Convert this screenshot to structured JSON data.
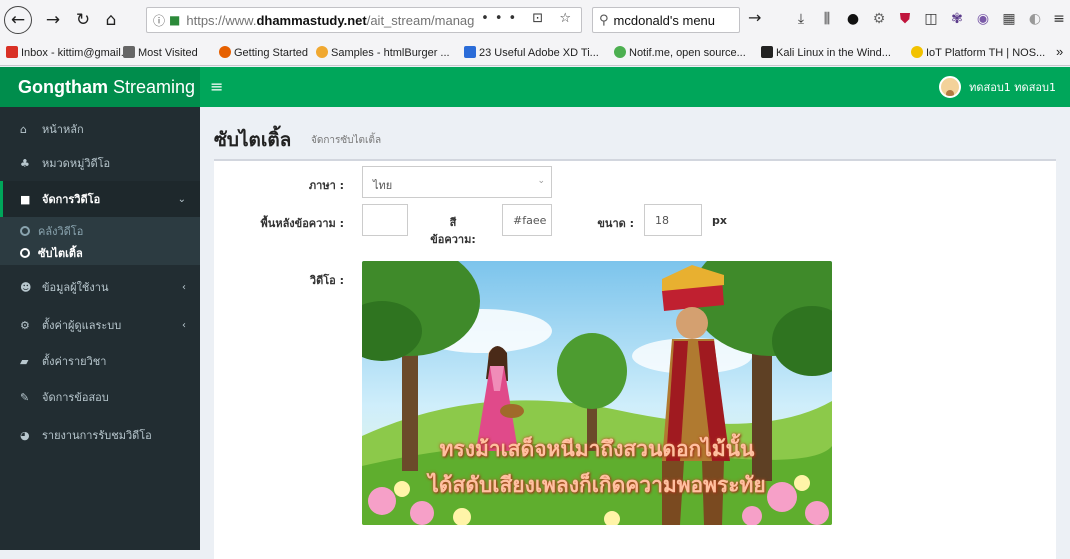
{
  "browser": {
    "url_prefix": "https://www.",
    "url_domain": "dhammastudy.net",
    "url_path": "/ait_stream/manage/subtitl",
    "page_actions": "••• ⊡ ☆",
    "search_text": "mcdonald's menu",
    "bookmarks": [
      {
        "label": "Inbox - kittim@gmail....",
        "color": "#d93025"
      },
      {
        "label": "Most Visited",
        "color": "#666666"
      },
      {
        "label": "Getting Started",
        "color": "#e66000"
      },
      {
        "label": "Samples - htmlBurger ...",
        "color": "#f0a830"
      },
      {
        "label": "23 Useful Adobe XD Ti...",
        "color": "#2b6cd8"
      },
      {
        "label": "Notif.me, open source...",
        "color": "#4caf50"
      },
      {
        "label": "Kali Linux in the Wind...",
        "color": "#222222"
      },
      {
        "label": "IoT Platform TH | NOS...",
        "color": "#f2c200"
      }
    ],
    "overflow": "»"
  },
  "app": {
    "logo_bold": "Gongtham",
    "logo_rest": " Streaming",
    "menu_icon": "≡",
    "user_name": "ทดสอบ1 ทดสอบ1"
  },
  "sidebar": {
    "items": [
      {
        "label": "หน้าหลัก",
        "icon": "home-icon",
        "glyph": "⌂"
      },
      {
        "label": "หมวดหมู่วิดีโอ",
        "icon": "sitemap-icon",
        "glyph": "♣"
      },
      {
        "label": "จัดการวิดีโอ",
        "icon": "video-icon",
        "glyph": "■"
      },
      {
        "label": "ข้อมูลผู้ใช้งาน",
        "icon": "users-icon",
        "glyph": "☻"
      },
      {
        "label": "ตั้งค่าผู้ดูแลระบบ",
        "icon": "cogs-icon",
        "glyph": "⚙"
      },
      {
        "label": "ตั้งค่ารายวิชา",
        "icon": "book-icon",
        "glyph": "▰"
      },
      {
        "label": "จัดการข้อสอบ",
        "icon": "edit-icon",
        "glyph": "✎"
      },
      {
        "label": "รายงานการรับชมวิดีโอ",
        "icon": "chart-pie-icon",
        "glyph": "◕"
      }
    ],
    "sub_items": [
      {
        "label": "คลังวิดีโอ"
      },
      {
        "label": "ซับไตเติ้ล"
      }
    ]
  },
  "page": {
    "title": "ซับไตเติ้ล",
    "subtitle": "จัดการซับไตเติ้ล"
  },
  "form": {
    "language_label": "ภาษา :",
    "language_value": "ไทย",
    "bg_label": "พื้นหลังข้อความ :",
    "text_color_label": "สีข้อความ:",
    "text_color_value": "#faee",
    "size_label": "ขนาด :",
    "size_value": "18",
    "size_unit": "px",
    "video_label": "วิดีโอ :"
  },
  "video": {
    "subtitle_line1": "ทรงม้าเสด็จหนีมาถึงสวนดอกไม้นั้น",
    "subtitle_line2": "ได้สดับเสียงเพลงก็เกิดความพอพระทัย"
  },
  "colors": {
    "header_green": "#00a65a",
    "logo_green": "#008d4c",
    "sidebar": "#222d32"
  }
}
